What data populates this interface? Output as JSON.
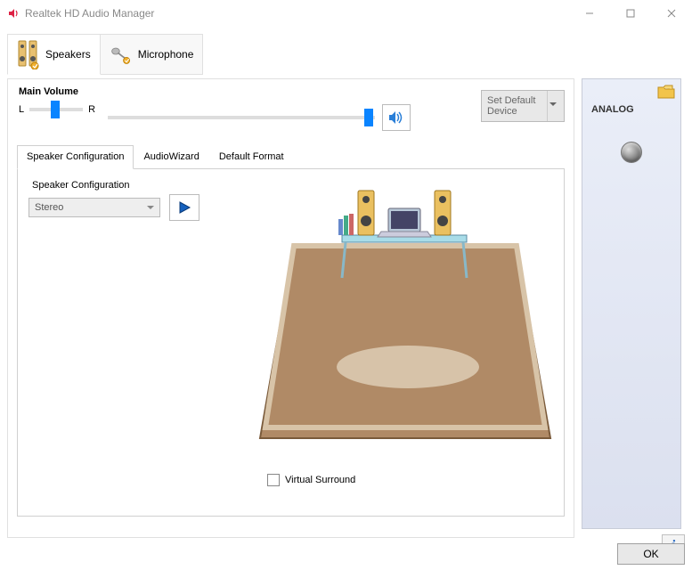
{
  "window": {
    "title": "Realtek HD Audio Manager"
  },
  "device_tabs": {
    "speakers": "Speakers",
    "microphone": "Microphone"
  },
  "main_volume": {
    "label": "Main Volume",
    "left_label": "L",
    "right_label": "R",
    "balance_percent": 40,
    "master_percent": 98
  },
  "default_device_button": "Set Default Device",
  "sub_tabs": {
    "speaker_config": "Speaker Configuration",
    "audiowizard": "AudioWizard",
    "default_format": "Default Format"
  },
  "speaker_config": {
    "group_label": "Speaker Configuration",
    "selected": "Stereo"
  },
  "virtual_surround_label": "Virtual Surround",
  "side": {
    "title": "ANALOG"
  },
  "ok_label": "OK"
}
